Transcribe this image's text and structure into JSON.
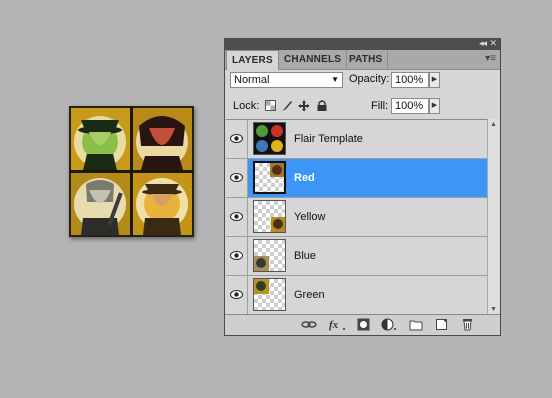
{
  "panel": {
    "tabs": [
      {
        "label": "LAYERS",
        "active": true
      },
      {
        "label": "CHANNELS",
        "active": false
      },
      {
        "label": "PATHS",
        "active": false
      }
    ],
    "collapse_icon": "double-chevron-icon",
    "close_icon": "close-icon",
    "menu_icon": "panel-menu-icon",
    "blend_mode": "Normal",
    "opacity_label": "Opacity:",
    "opacity_value": "100%",
    "lock_label": "Lock:",
    "fill_label": "Fill:",
    "fill_value": "100%",
    "lock_icons": [
      "lock-transparent-pixels-icon",
      "lock-image-pixels-icon",
      "lock-position-icon",
      "lock-all-icon"
    ]
  },
  "layers": [
    {
      "name": "Flair Template",
      "visible": true,
      "selected": false
    },
    {
      "name": "Red",
      "visible": true,
      "selected": true
    },
    {
      "name": "Yellow",
      "visible": true,
      "selected": false
    },
    {
      "name": "Blue",
      "visible": true,
      "selected": false
    },
    {
      "name": "Green",
      "visible": true,
      "selected": false
    }
  ],
  "bottom_icons": [
    "link-layers-icon",
    "layer-style-fx-icon",
    "layer-mask-icon",
    "adjustment-layer-icon",
    "new-group-folder-icon",
    "new-layer-icon",
    "trash-icon"
  ],
  "colors": {
    "selection": "#3d96f5",
    "swatch_green": "#4f9a3a",
    "swatch_red": "#c8322a",
    "swatch_blue": "#3f78b4",
    "swatch_yellow": "#e2b21c"
  }
}
